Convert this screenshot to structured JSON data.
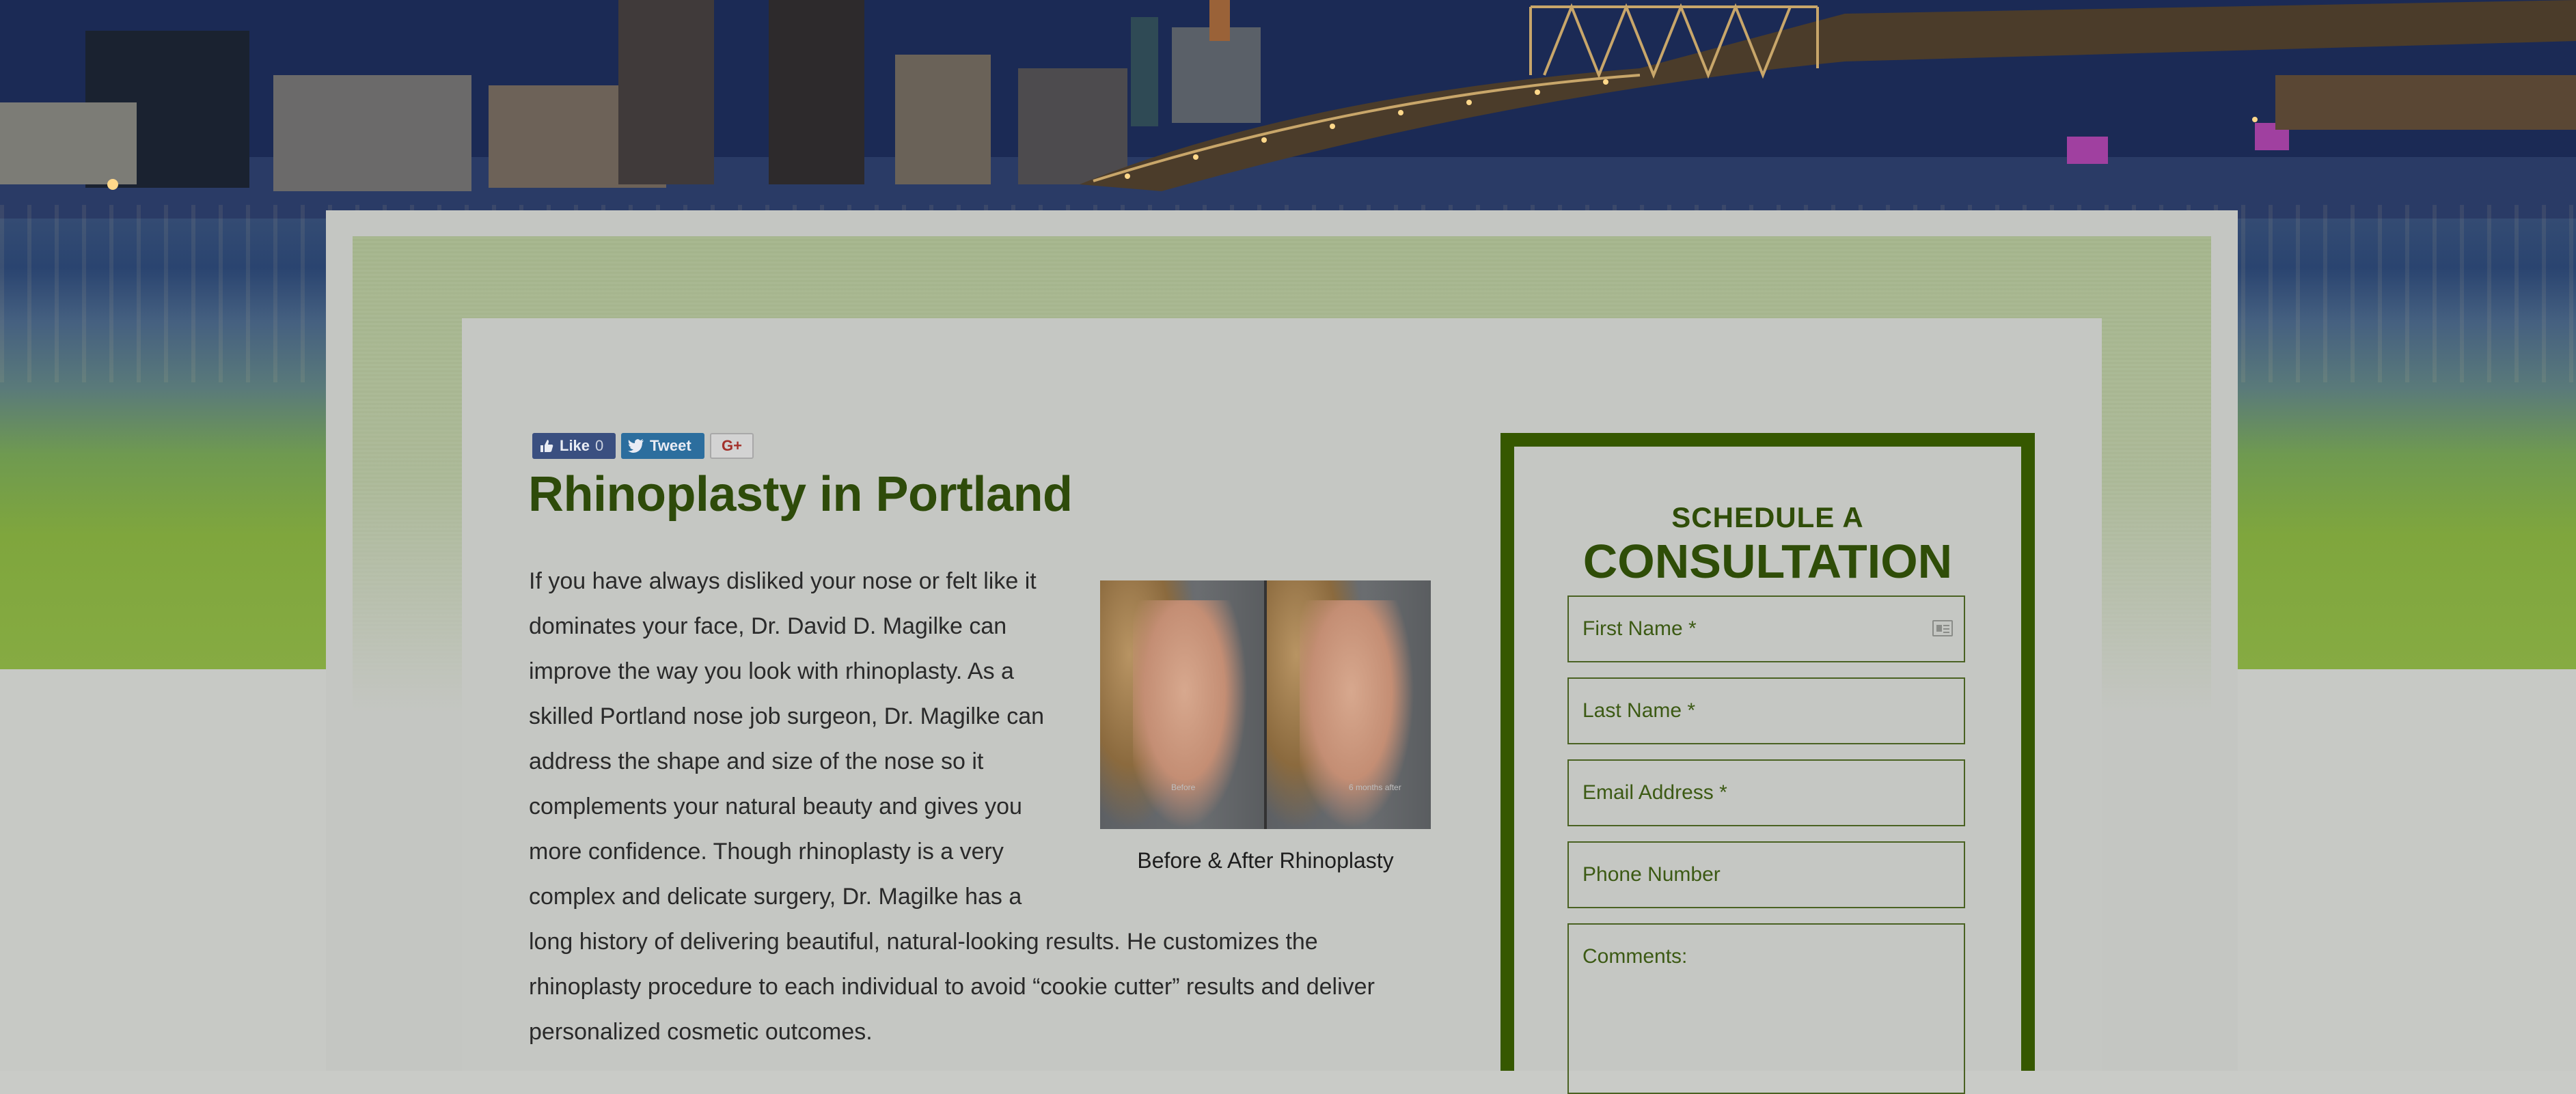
{
  "social": {
    "like_label": "Like",
    "like_count": "0",
    "tweet_label": "Tweet",
    "gplus_label": "G+"
  },
  "page": {
    "title": "Rhinoplasty in Portland",
    "paragraph": "If you have always disliked your nose or felt like it dominates your face, Dr. David D. Magilke can improve the way you look with rhinoplasty. As a skilled Portland nose job surgeon, Dr. Magilke can address the shape and size of the nose so it complements your natural beauty and gives you more confidence. Though rhinoplasty is a very complex and delicate surgery, Dr. Magilke has a long history of delivering beautiful, natural-looking results. He customizes the rhinoplasty procedure to each individual to avoid “cookie cutter” results and deliver personalized cosmetic outcomes.",
    "image_caption": "Before & After Rhinoplasty",
    "photo_label_before": "Before",
    "photo_label_after": "6 months after"
  },
  "form": {
    "heading_small": "SCHEDULE A",
    "heading_large": "CONSULTATION",
    "first_name": "First Name *",
    "last_name": "Last Name *",
    "email": "Email Address *",
    "phone": "Phone Number",
    "comments": "Comments:"
  },
  "colors": {
    "brand_green": "#365800",
    "heading_green": "#2e4b0a"
  }
}
